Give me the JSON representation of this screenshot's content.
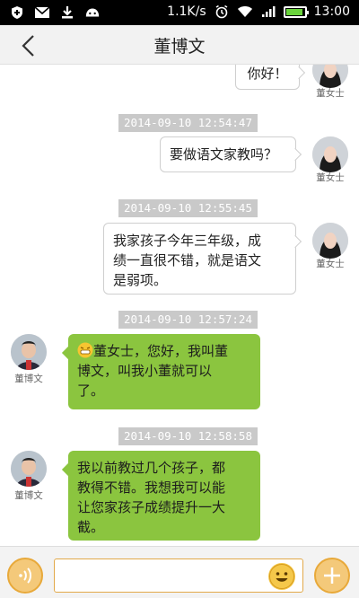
{
  "status_bar": {
    "speed": "1.1K/s",
    "time": "13:00",
    "icons": [
      "shield-plus-icon",
      "mail-icon",
      "download-icon",
      "android-icon",
      "alarm-icon",
      "wifi-icon",
      "signal-icon",
      "battery-icon"
    ],
    "battery_level": 0.85
  },
  "header": {
    "title": "董博文"
  },
  "messages": [
    {
      "side": "right",
      "sender": "董女士",
      "text": "你好！",
      "timestamp": ""
    },
    {
      "side": "right",
      "sender": "董女士",
      "text": "要做语文家教吗？",
      "timestamp": "2014-09-10 12:54:47"
    },
    {
      "side": "right",
      "sender": "董女士",
      "text": "我家孩子今年三年级，成绩一直很不错，就是语文是弱项。",
      "timestamp": "2014-09-10 12:55:45"
    },
    {
      "side": "left",
      "sender": "董博文",
      "text": "董女士，您好，我叫董博文，叫我小董就可以了。",
      "timestamp": "2014-09-10 12:57:24"
    },
    {
      "side": "left",
      "sender": "董博文",
      "text": "我以前教过几个孩子，都教得不错。我想我可以能让您家孩子成绩提升一大截。",
      "timestamp": "2014-09-10 12:58:58"
    }
  ],
  "bubble_lines": {
    "m2": [
      "我家孩子今年三年级，成",
      "绩一直很不错，就是语文",
      "是弱项。"
    ],
    "m3": [
      "董女士，您好，我叫董",
      "博文，叫我小董就可以",
      "了。"
    ],
    "m4": [
      "我以前教过几个孩子，都",
      "教得不错。我想我可以能",
      "让您家孩子成绩提升一大",
      "截。"
    ]
  },
  "input": {
    "placeholder": ""
  },
  "colors": {
    "incoming_bubble": "#8bc53f",
    "accent_button": "#f4c97a"
  }
}
